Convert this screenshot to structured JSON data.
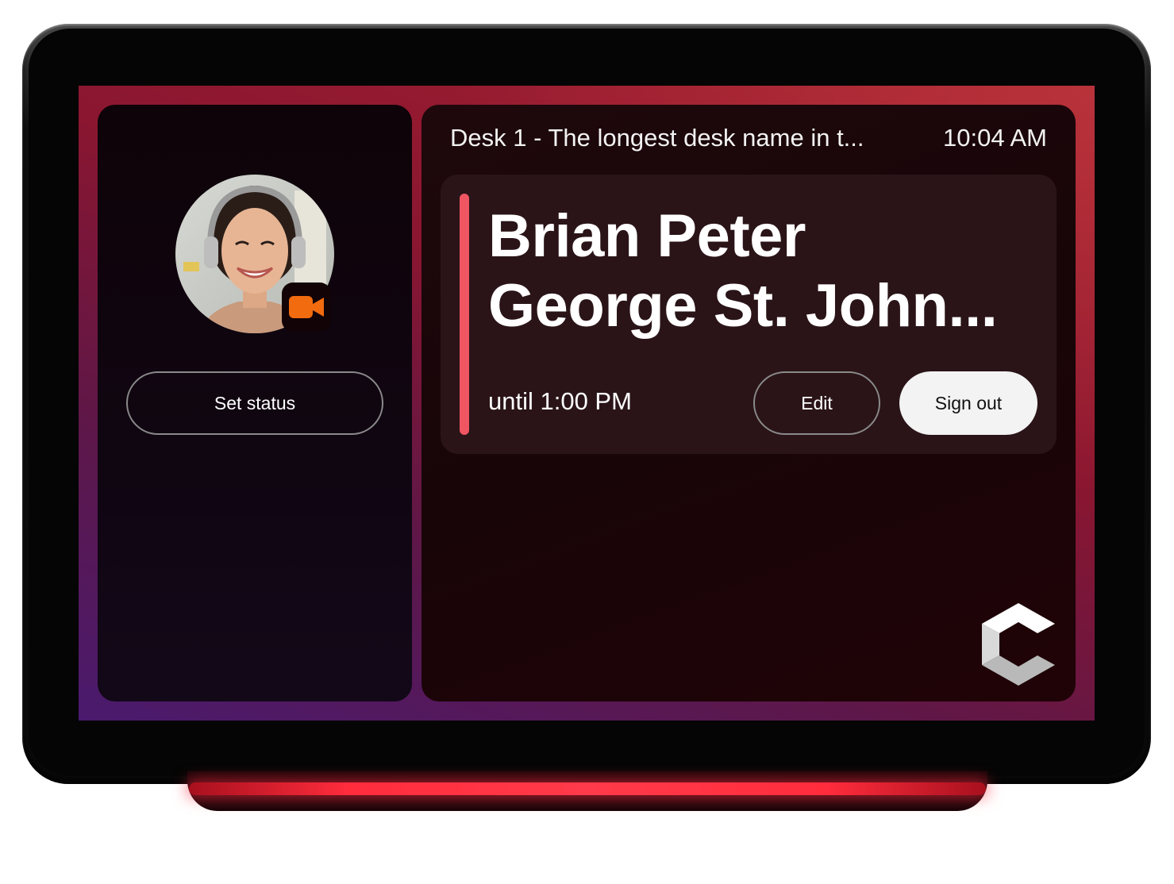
{
  "header": {
    "desk_name": "Desk 1 - The longest desk name in t...",
    "time": "10:04 AM"
  },
  "left_panel": {
    "set_status_label": "Set status",
    "avatar_icon": "user-avatar-photo",
    "badge_icon": "video-camera-icon"
  },
  "booking": {
    "name_line1": "Brian Peter",
    "name_line2": "George St. John...",
    "until": "until 1:00 PM",
    "edit_label": "Edit",
    "signout_label": "Sign out"
  },
  "colors": {
    "accent": "#f05562",
    "camera_badge": "#f26b0f",
    "led_strip": "#ff2c3c"
  }
}
